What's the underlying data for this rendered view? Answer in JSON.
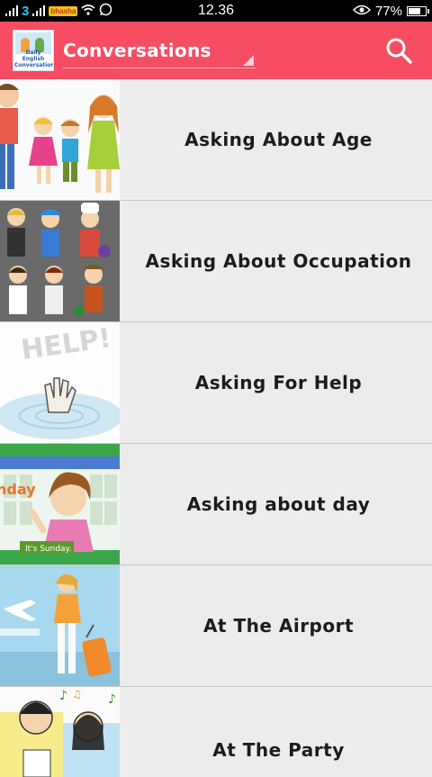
{
  "status_bar": {
    "carrier": "3",
    "badge": "bhasha",
    "time": "12.36",
    "battery_percent": "77%",
    "battery_level": 0.77
  },
  "app_bar": {
    "title": "Conversations",
    "logo_text": "Daily English Conversation",
    "search_icon": "search-icon",
    "background": "#f64d63"
  },
  "items": [
    {
      "label": "Asking About Age",
      "image": "family-illustration"
    },
    {
      "label": "Asking About Occupation",
      "image": "occupations-illustration"
    },
    {
      "label": "Asking For Help",
      "image": "help-hand-illustration"
    },
    {
      "label": "Asking about day",
      "image": "calendar-girl-illustration",
      "caption": "It's Sunday."
    },
    {
      "label": "At The Airport",
      "image": "airport-traveler-illustration"
    },
    {
      "label": "At The Party",
      "image": "party-singers-illustration"
    }
  ]
}
